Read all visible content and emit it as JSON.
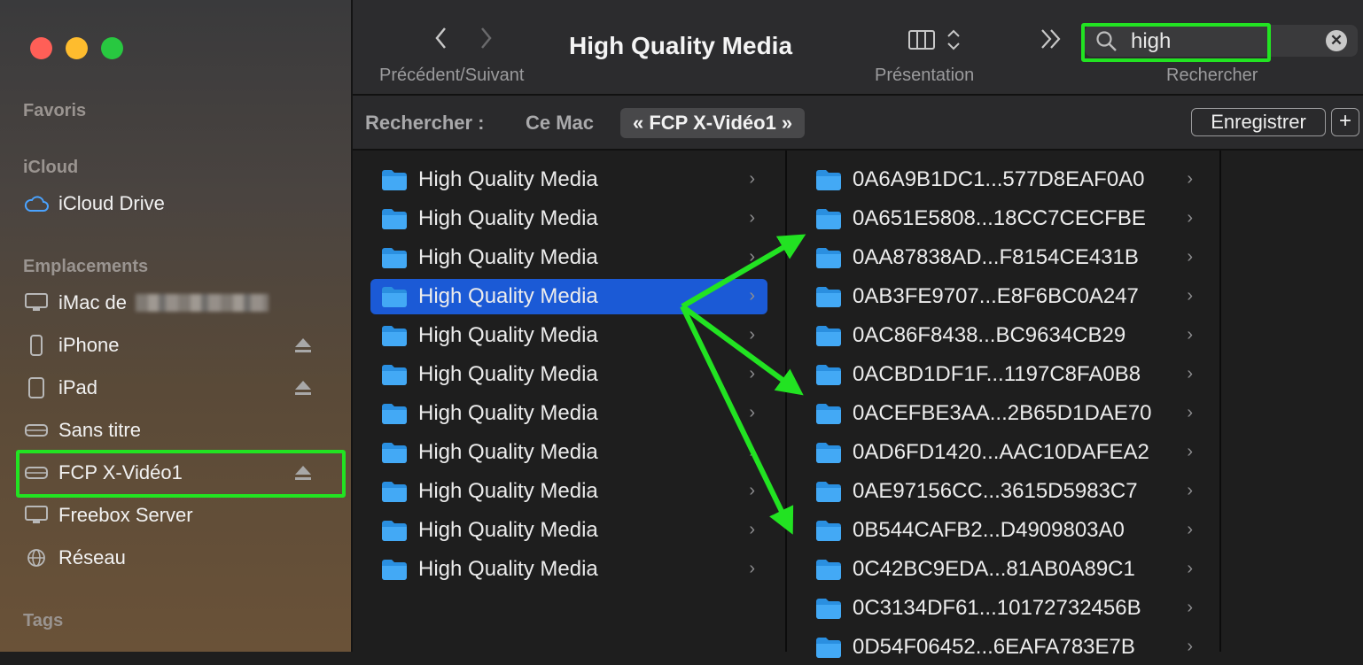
{
  "window": {
    "title": "High Quality Media",
    "nav_label": "Précédent/Suivant",
    "view_label": "Présentation",
    "search_label": "Rechercher",
    "search_value": "high"
  },
  "sidebar": {
    "favorites_header": "Favoris",
    "icloud_header": "iCloud",
    "icloud_drive": "iCloud Drive",
    "locations_header": "Emplacements",
    "imac_label": "iMac de",
    "iphone": "iPhone",
    "ipad": "iPad",
    "sans_titre": "Sans titre",
    "fcp": "FCP X-Vidéo1",
    "freebox": "Freebox Server",
    "reseau": "Réseau",
    "tags_header": "Tags"
  },
  "scope": {
    "label": "Rechercher :",
    "ce_mac": "Ce Mac",
    "active": "« FCP X-Vidéo1 »",
    "save": "Enregistrer",
    "add": "+"
  },
  "column1": [
    "High Quality Media",
    "High Quality Media",
    "High Quality Media",
    "High Quality Media",
    "High Quality Media",
    "High Quality Media",
    "High Quality Media",
    "High Quality Media",
    "High Quality Media",
    "High Quality Media",
    "High Quality Media"
  ],
  "column2": [
    "0A6A9B1DC1...577D8EAF0A0",
    "0A651E5808...18CC7CECFBE",
    "0AA87838AD...F8154CE431B",
    "0AB3FE9707...E8F6BC0A247",
    "0AC86F8438...BC9634CB29",
    "0ACBD1DF1F...1197C8FA0B8",
    "0ACEFBE3AA...2B65D1DAE70",
    "0AD6FD1420...AAC10DAFEA2",
    "0AE97156CC...3615D5983C7",
    "0B544CAFB2...D4909803A0",
    "0C42BC9EDA...81AB0A89C1",
    "0C3134DF61...10172732456B",
    "0D54F06452...6EAFA783E7B"
  ],
  "colors": {
    "accent": "#1b5ad6",
    "highlight": "#22e322"
  }
}
